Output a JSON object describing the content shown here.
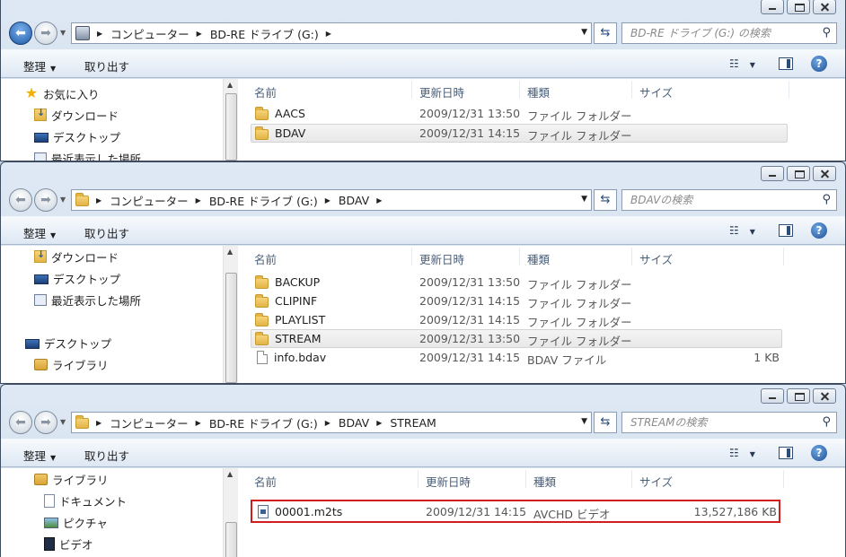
{
  "windows": [
    {
      "breadcrumb": [
        "コンピューター",
        "BD-RE ドライブ (G:)"
      ],
      "breadcrumb_icon": "drive-icon",
      "search_placeholder": "BD-RE ドライブ (G:) の検索",
      "back_active": true,
      "nav_items": [
        {
          "label": "お気に入り",
          "icon": "star-icon"
        },
        {
          "label": "ダウンロード",
          "icon": "downloads-folder-icon"
        },
        {
          "label": "デスクトップ",
          "icon": "desktop-icon"
        },
        {
          "label": "最近表示した場所",
          "icon": "recent-places-icon"
        }
      ],
      "columns": {
        "name": "名前",
        "date": "更新日時",
        "type": "種類",
        "size": "サイズ"
      },
      "files": [
        {
          "name": "AACS",
          "date": "2009/12/31 13:50",
          "type": "ファイル フォルダー",
          "size": "",
          "icon": "folder-icon"
        },
        {
          "name": "BDAV",
          "date": "2009/12/31 14:15",
          "type": "ファイル フォルダー",
          "size": "",
          "icon": "folder-icon"
        }
      ]
    },
    {
      "breadcrumb": [
        "コンピューター",
        "BD-RE ドライブ (G:)",
        "BDAV"
      ],
      "breadcrumb_icon": "folder-icon",
      "search_placeholder": "BDAVの検索",
      "back_active": false,
      "nav_items": [
        {
          "label": "ダウンロード",
          "icon": "downloads-folder-icon"
        },
        {
          "label": "デスクトップ",
          "icon": "desktop-icon"
        },
        {
          "label": "最近表示した場所",
          "icon": "recent-places-icon"
        },
        {
          "label": "デスクトップ",
          "icon": "desktop-icon"
        },
        {
          "label": "ライブラリ",
          "icon": "library-icon"
        }
      ],
      "columns": {
        "name": "名前",
        "date": "更新日時",
        "type": "種類",
        "size": "サイズ"
      },
      "files": [
        {
          "name": "BACKUP",
          "date": "2009/12/31 13:50",
          "type": "ファイル フォルダー",
          "size": "",
          "icon": "folder-icon"
        },
        {
          "name": "CLIPINF",
          "date": "2009/12/31 14:15",
          "type": "ファイル フォルダー",
          "size": "",
          "icon": "folder-icon"
        },
        {
          "name": "PLAYLIST",
          "date": "2009/12/31 14:15",
          "type": "ファイル フォルダー",
          "size": "",
          "icon": "folder-icon"
        },
        {
          "name": "STREAM",
          "date": "2009/12/31 13:50",
          "type": "ファイル フォルダー",
          "size": "",
          "icon": "folder-icon"
        },
        {
          "name": "info.bdav",
          "date": "2009/12/31 14:15",
          "type": "BDAV ファイル",
          "size": "1 KB",
          "icon": "file-icon"
        }
      ]
    },
    {
      "breadcrumb": [
        "コンピューター",
        "BD-RE ドライブ (G:)",
        "BDAV",
        "STREAM"
      ],
      "breadcrumb_icon": "folder-icon",
      "search_placeholder": "STREAMの検索",
      "back_active": false,
      "nav_items": [
        {
          "label": "ライブラリ",
          "icon": "library-icon"
        },
        {
          "label": "ドキュメント",
          "icon": "documents-icon"
        },
        {
          "label": "ピクチャ",
          "icon": "pictures-icon"
        },
        {
          "label": "ビデオ",
          "icon": "videos-icon"
        }
      ],
      "columns": {
        "name": "名前",
        "date": "更新日時",
        "type": "種類",
        "size": "サイズ"
      },
      "files": [
        {
          "name": "00001.m2ts",
          "date": "2009/12/31 14:15",
          "type": "AVCHD ビデオ",
          "size": "13,527,186 KB",
          "icon": "video-file-icon"
        }
      ]
    }
  ],
  "toolbar": {
    "organize": "整理",
    "eject": "取り出す",
    "help": "?"
  },
  "selection": {
    "window1": "BDAV",
    "window2": "STREAM",
    "window3_highlighted": "00001.m2ts"
  },
  "colors": {
    "highlight_border": "#d21d1d",
    "back_button": "#1d5aa9"
  }
}
